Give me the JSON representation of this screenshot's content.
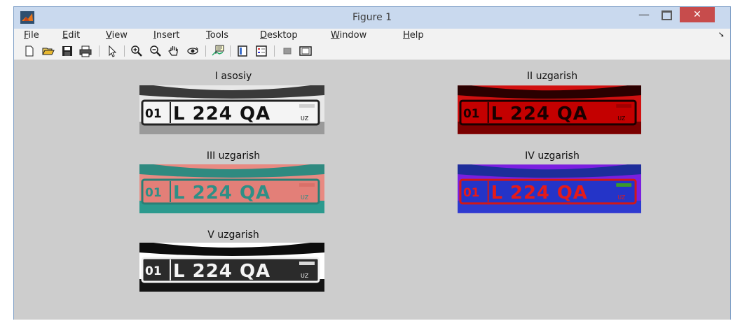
{
  "window": {
    "title": "Figure 1",
    "minimize_glyph": "—",
    "close_glyph": "✕"
  },
  "menubar": {
    "items": [
      {
        "label": "File",
        "accel": "F",
        "rest": "ile"
      },
      {
        "label": "Edit",
        "accel": "E",
        "rest": "dit"
      },
      {
        "label": "View",
        "accel": "V",
        "rest": "iew"
      },
      {
        "label": "Insert",
        "accel": "I",
        "rest": "nsert"
      },
      {
        "label": "Tools",
        "accel": "T",
        "rest": "ools"
      },
      {
        "label": "Desktop",
        "accel": "D",
        "rest": "esktop"
      },
      {
        "label": "Window",
        "accel": "W",
        "rest": "indow"
      },
      {
        "label": "Help",
        "accel": "H",
        "rest": "elp"
      }
    ],
    "overflow_glyph": "➘"
  },
  "toolbar": {
    "icons": [
      "new-file-icon",
      "open-file-icon",
      "save-icon",
      "print-icon",
      "pointer-icon",
      "zoom-in-icon",
      "zoom-out-icon",
      "pan-hand-icon",
      "rotate-3d-icon",
      "data-cursor-icon",
      "colorbar-icon",
      "legend-icon",
      "hide-plot-tools-icon",
      "show-plot-tools-icon"
    ]
  },
  "figure": {
    "plots": [
      {
        "title": "I  asosiy",
        "plate_text": "L 224 QA",
        "region": "01",
        "country": "UZ",
        "variant": "original"
      },
      {
        "title": "II uzgarish",
        "plate_text": "L 224 QA",
        "region": "01",
        "country": "UZ",
        "variant": "red"
      },
      {
        "title": "III uzgarish",
        "plate_text": "L 224 QA",
        "region": "01",
        "country": "UZ",
        "variant": "teal"
      },
      {
        "title": "IV uzgarish",
        "plate_text": "L 224 QA",
        "region": "01",
        "country": "UZ",
        "variant": "purple"
      },
      {
        "title": "V uzgarish",
        "plate_text": "L 224 QA",
        "region": "01",
        "country": "UZ",
        "variant": "contrast"
      }
    ]
  },
  "colors": {
    "titlebar": "#c9d9ee",
    "close_button": "#c74c4c",
    "figure_background": "#cdcdcd"
  }
}
